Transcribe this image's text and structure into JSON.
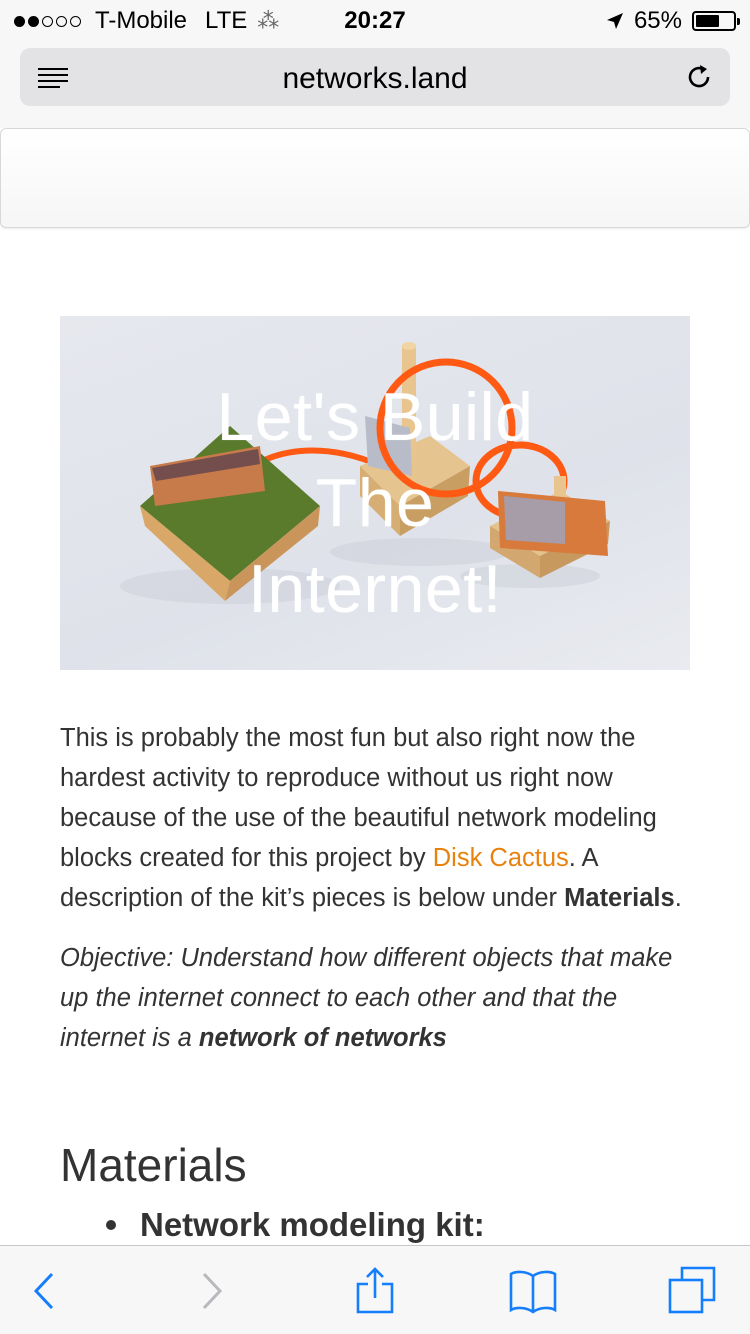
{
  "status_bar": {
    "carrier": "T-Mobile",
    "network": "LTE",
    "time": "20:27",
    "battery_text": "65%",
    "battery_level": 0.65,
    "signal_bars_filled": 2,
    "signal_bars_total": 5
  },
  "browser": {
    "url": "networks.land",
    "reader_icon": "reader-lines-icon",
    "reload_icon": "reload-icon"
  },
  "hero": {
    "title_line1": "Let's Build",
    "title_line2": "The",
    "title_line3": "Internet!"
  },
  "article": {
    "intro_text": "This is probably the most fun but also right now the hardest activity to reproduce without us right now because of the use of the beautiful network modeling blocks created for this project by ",
    "intro_link": "Disk Cactus",
    "intro_after_link": ". A description of the kit’s pieces is below under ",
    "intro_bold": "Materials",
    "intro_end": ".",
    "objective_text": "Objective: Understand how different objects that make up the internet connect to each other and that the internet is a ",
    "objective_bold": "network of networks",
    "materials_heading": "Materials",
    "materials_item_1": "Network modeling kit:"
  },
  "toolbar": {
    "back_icon": "back-chevron-icon",
    "forward_icon": "forward-chevron-icon",
    "share_icon": "share-icon",
    "bookmarks_icon": "bookmarks-icon",
    "tabs_icon": "tabs-icon"
  },
  "colors": {
    "link": "#e8820e",
    "text": "#333333",
    "ios_blue": "#157efb"
  }
}
